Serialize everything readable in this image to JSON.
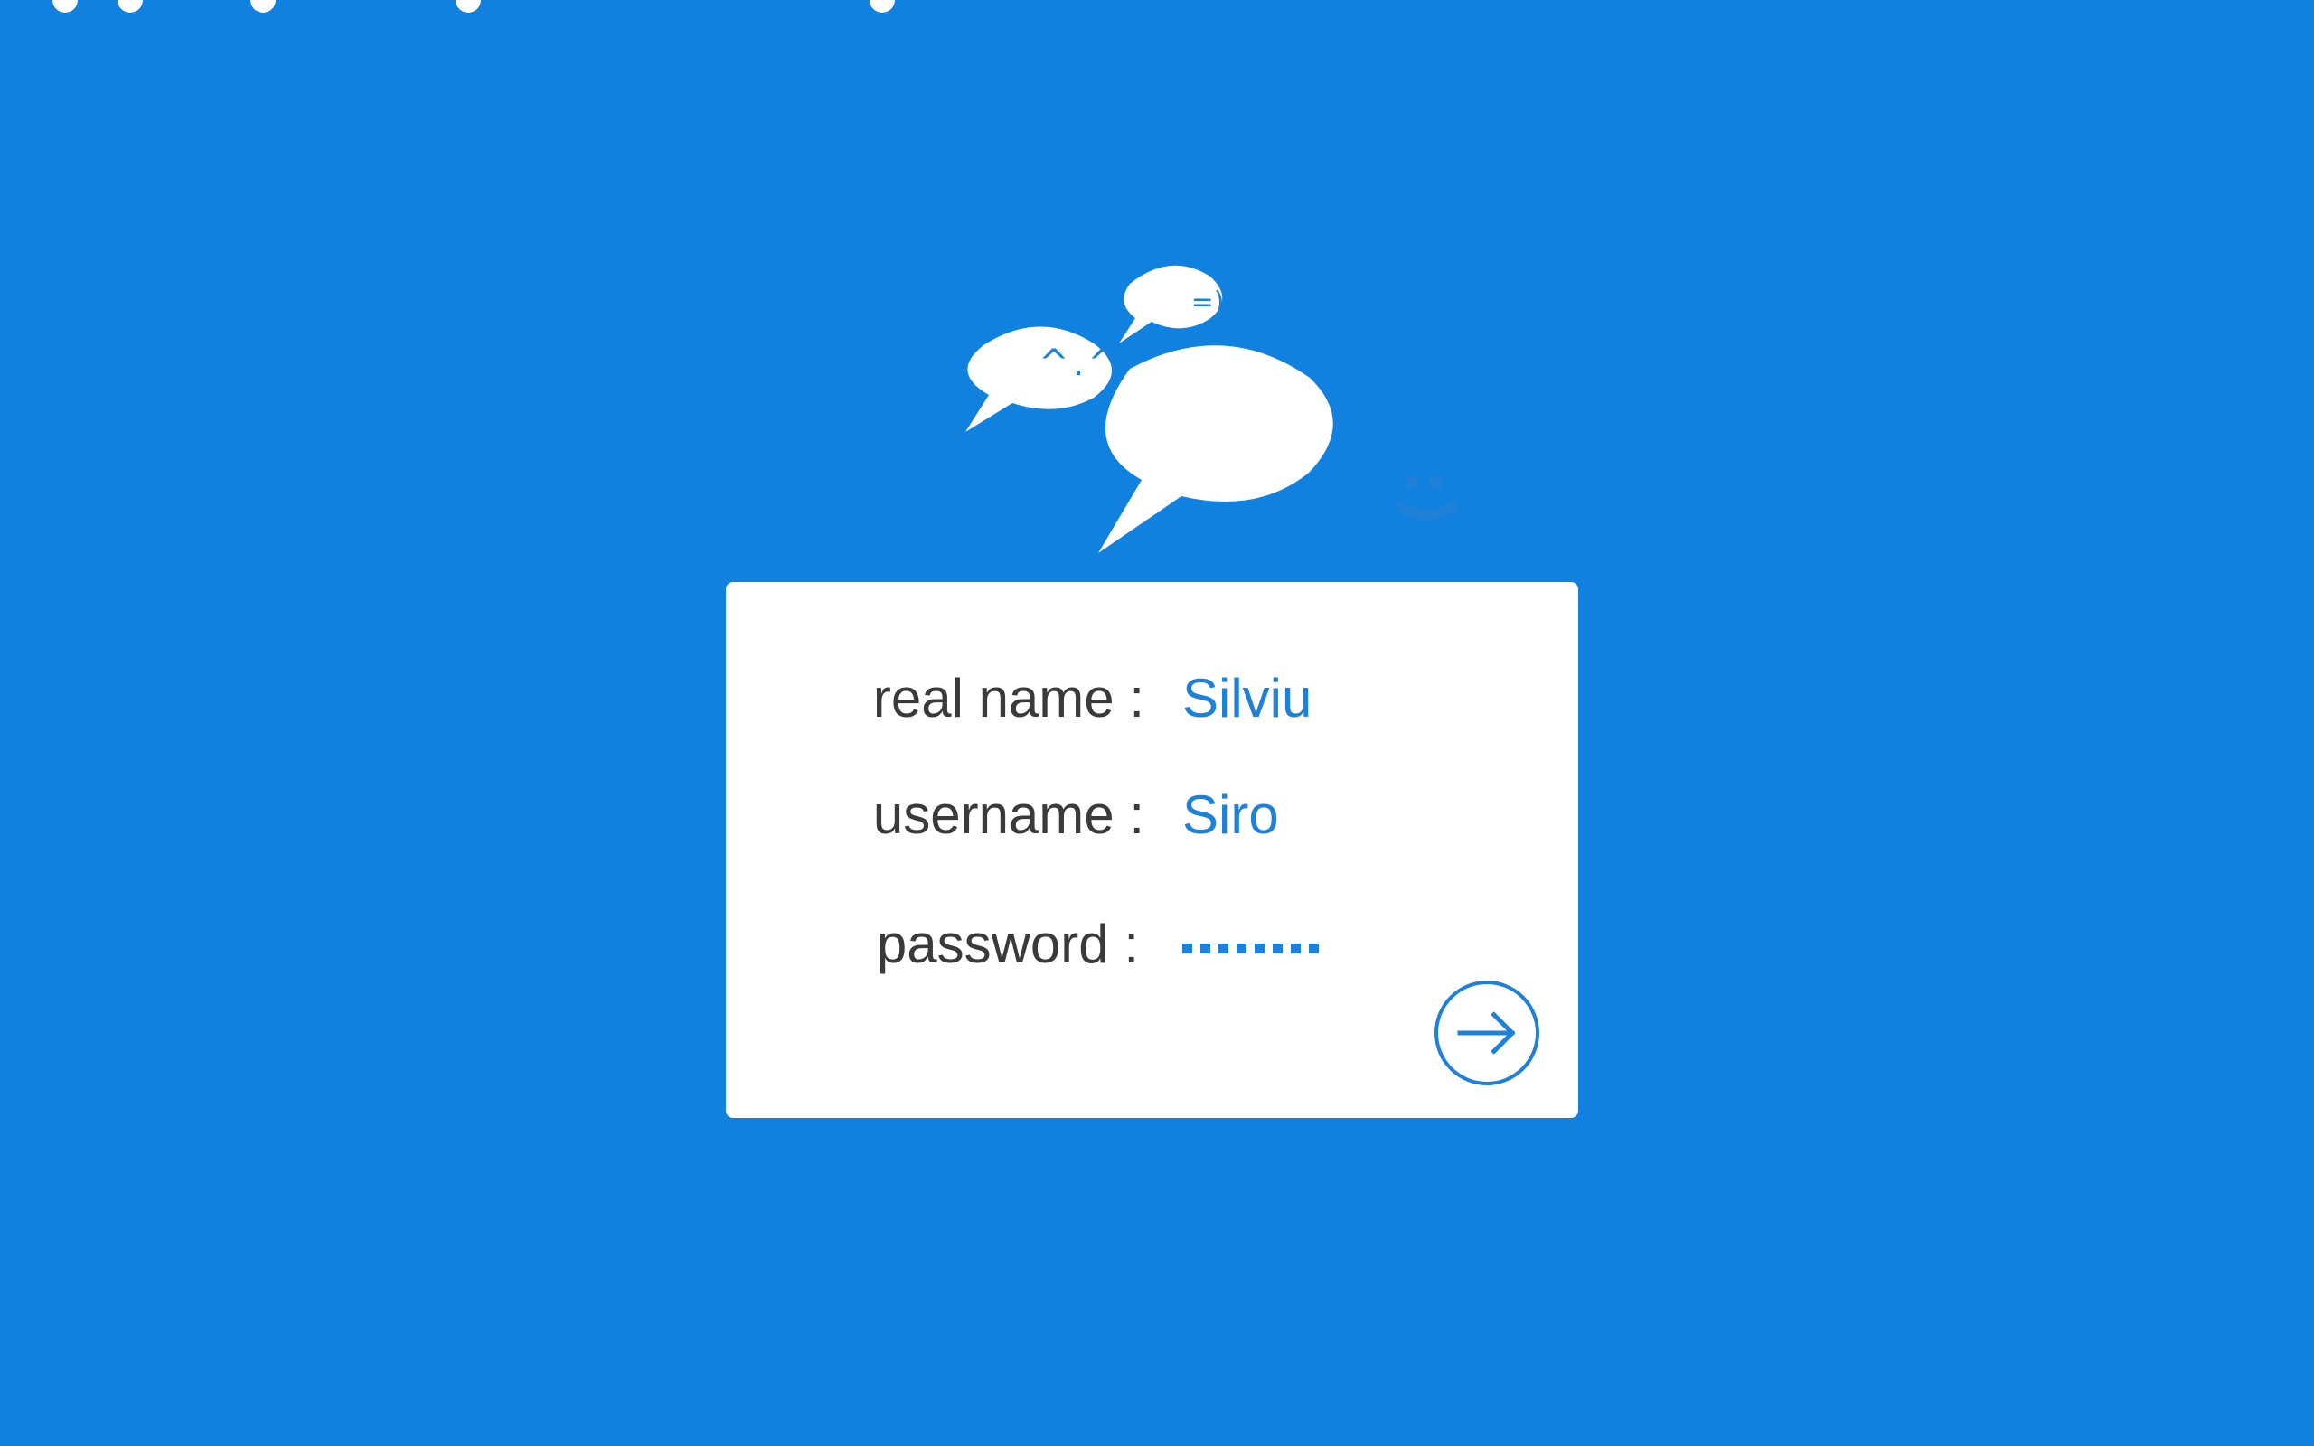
{
  "colors": {
    "background": "#1181df",
    "card": "#ffffff",
    "label_text": "#3a3a3a",
    "value_text": "#1f80d8",
    "accent": "#1f80d8",
    "bubble": "#ffffff"
  },
  "chat_icon": {
    "small_bubble_face": "=)",
    "medium_bubble_face": "^.^",
    "large_bubble_face": ":)"
  },
  "form": {
    "real_name_label": "real name :",
    "real_name_value": "Silviu",
    "username_label": "username :",
    "username_value": "Siro",
    "password_label": "password :",
    "password_mask_count": 8,
    "submit_icon": "arrow-right-icon"
  }
}
